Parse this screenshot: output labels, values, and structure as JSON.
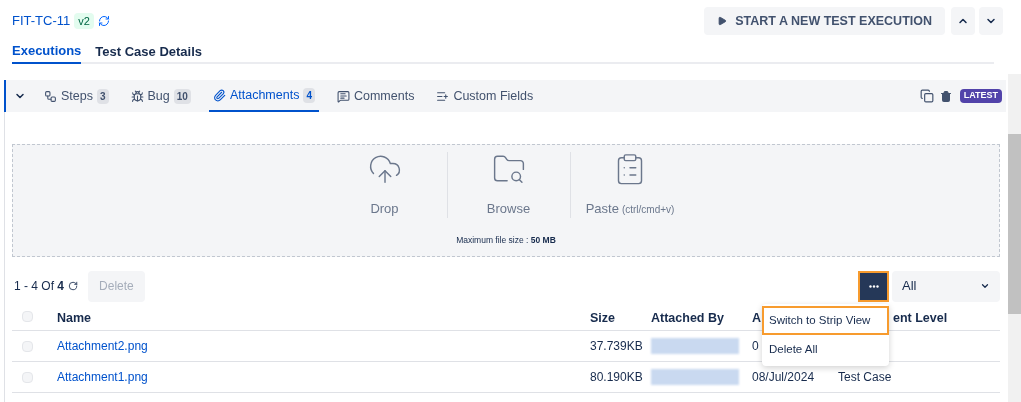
{
  "header": {
    "key": "FIT-TC-11",
    "version": "v2",
    "start_button": "START A NEW TEST EXECUTION"
  },
  "tabs": [
    {
      "label": "Executions",
      "selected": true
    },
    {
      "label": "Test Case Details",
      "selected": false
    }
  ],
  "execution_tabs": [
    {
      "kind": "steps",
      "label": "Steps",
      "count": "3",
      "selected": false
    },
    {
      "kind": "bug",
      "label": "Bug",
      "count": "10",
      "selected": false
    },
    {
      "kind": "attachments",
      "label": "Attachments",
      "count": "4",
      "selected": true
    },
    {
      "kind": "comments",
      "label": "Comments",
      "selected": false
    },
    {
      "kind": "fields",
      "label": "Custom Fields",
      "selected": false
    }
  ],
  "latest_badge": "LATEST",
  "upload": {
    "options": [
      {
        "kind": "drop",
        "label": "Drop"
      },
      {
        "kind": "browse",
        "label": "Browse"
      },
      {
        "kind": "paste",
        "label": "Paste",
        "hint": "(ctrl/cmd+v)"
      }
    ],
    "max_size": "Maximum file size : **50 MB**"
  },
  "toolbar": {
    "range": "1 - 4 Of ",
    "total": "4",
    "delete_button": "Delete",
    "filter": "All"
  },
  "table": {
    "select_all_checked": false,
    "columns": [
      {
        "label": "Name"
      },
      {
        "label": "Size"
      },
      {
        "label": "Attached By"
      },
      {
        "label": "A"
      },
      {
        "label": "ent Level"
      }
    ],
    "rows": [
      {
        "checked": false,
        "name": "Attachment2.png",
        "size": "37.739KB",
        "date": "0"
      },
      {
        "checked": false,
        "name": "Attachment1.png",
        "size": "80.190KB",
        "date": "08/Jul/2024",
        "level": "Test Case"
      }
    ]
  },
  "menu": [
    {
      "label": "Switch to Strip View",
      "selected": true
    },
    {
      "label": "Delete All",
      "selected": false
    }
  ]
}
